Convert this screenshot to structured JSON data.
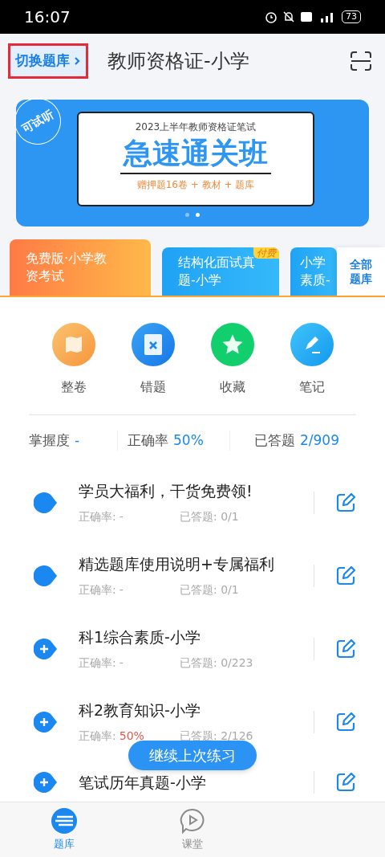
{
  "status_bar": {
    "time": "16:07",
    "battery": "73"
  },
  "header": {
    "switch_label": "切换题库",
    "switch_highlighted": true,
    "title": "教师资格证-小学"
  },
  "banner": {
    "badge": "可试听",
    "subtitle": "2023上半年教师资格证笔试",
    "headline": "急速通关班",
    "offer": "赠押题16卷 + 教材 + 题库",
    "pages": [
      {
        "selected": false
      },
      {
        "selected": true
      }
    ]
  },
  "bank_cards": [
    {
      "kind": "free",
      "lines": [
        "免费版·小学教",
        "资考试"
      ],
      "selected": true
    },
    {
      "kind": "paid",
      "lines": [
        "结构化面试真",
        "题-小学"
      ],
      "tag": "付费",
      "selected": false
    },
    {
      "kind": "paid",
      "lines": [
        "小学",
        "素质-"
      ],
      "selected": false
    }
  ],
  "all_banks": {
    "label": "全部题库"
  },
  "tools": [
    {
      "kind": "book",
      "label": "整卷"
    },
    {
      "kind": "wrong",
      "label": "错题"
    },
    {
      "kind": "star",
      "label": "收藏"
    },
    {
      "kind": "note",
      "label": "笔记"
    }
  ],
  "stats": [
    {
      "label": "掌握度",
      "value": "-"
    },
    {
      "label": "正确率",
      "value": "50%"
    },
    {
      "label": "已答题",
      "value": "2/909"
    }
  ],
  "chapters": [
    {
      "kind": "dot",
      "title": "学员大福利，干货免费领!",
      "accuracy_label": "正确率:",
      "accuracy": "-",
      "accuracy_low": false,
      "answered": "已答题: 0/1"
    },
    {
      "kind": "dot",
      "title": "精选题库使用说明+专属福利",
      "accuracy_label": "正确率:",
      "accuracy": "-",
      "accuracy_low": false,
      "answered": "已答题: 0/1"
    },
    {
      "kind": "plus",
      "title": "科1综合素质-小学",
      "accuracy_label": "正确率:",
      "accuracy": "-",
      "accuracy_low": false,
      "answered": "已答题: 0/223"
    },
    {
      "kind": "plus",
      "title": "科2教育知识-小学",
      "accuracy_label": "正确率:",
      "accuracy": "50%",
      "accuracy_low": true,
      "answered": "已答题: 2/126"
    },
    {
      "kind": "plus",
      "title": "笔试历年真题-小学"
    }
  ],
  "continue_button": "继续上次练习",
  "bottom_nav": [
    {
      "kind": "bank",
      "label": "题库",
      "selected": true
    },
    {
      "kind": "class",
      "label": "课堂",
      "selected": false
    }
  ]
}
